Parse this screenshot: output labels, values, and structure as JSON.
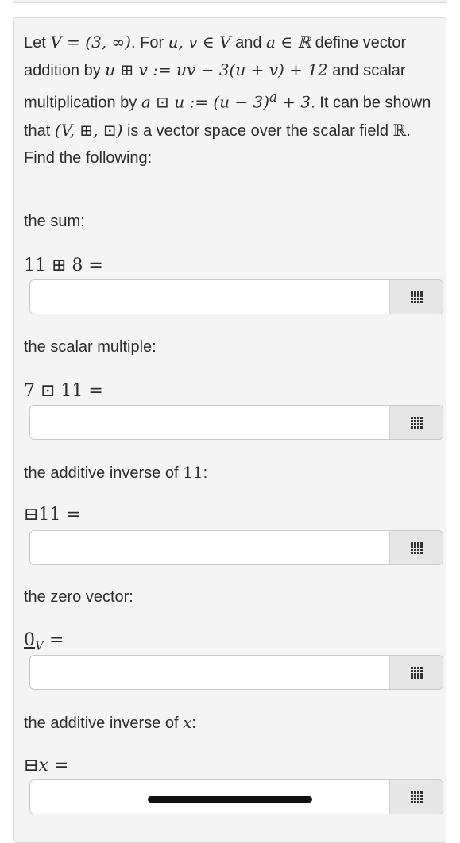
{
  "intro": {
    "t1": "Let ",
    "m1": "V = (3, ∞)",
    "t2": ". For ",
    "m2": "u, v ∈ V",
    "t3": " and ",
    "m3": "a ∈ ℝ",
    "t4": " define vector addition by ",
    "m4": "u ⊞ v := uv − 3(u + v) + 12",
    "t5": " and scalar multiplication by ",
    "m5": "a ⊡ u := (u − 3)",
    "m5sup": "a",
    "m5b": " + 3",
    "t6": ". It can be shown that ",
    "m6": "(V, ⊞, ⊡)",
    "t7": " is a vector space over the scalar field ",
    "m7": "ℝ",
    "t8": ". Find the following:"
  },
  "questions": [
    {
      "label": "the sum:",
      "expr": "11 ⊞ 8 =",
      "value": ""
    },
    {
      "label": "the scalar multiple:",
      "expr": "7 ⊡ 11 =",
      "value": ""
    },
    {
      "label_prefix": "the additive inverse of ",
      "label_math": "11",
      "label_suffix": ":",
      "expr": "⊟11 =",
      "value": ""
    },
    {
      "label": "the zero vector:",
      "expr_main": "0",
      "expr_sub": "V",
      "expr_tail": " =",
      "value": ""
    },
    {
      "label_prefix": "the additive inverse of ",
      "label_math": "x",
      "label_suffix": ":",
      "expr_op": "⊟",
      "expr_var": "x",
      "expr_tail": " =",
      "value": ""
    }
  ],
  "icons": {
    "math_palette": "math-palette-grid-icon"
  }
}
